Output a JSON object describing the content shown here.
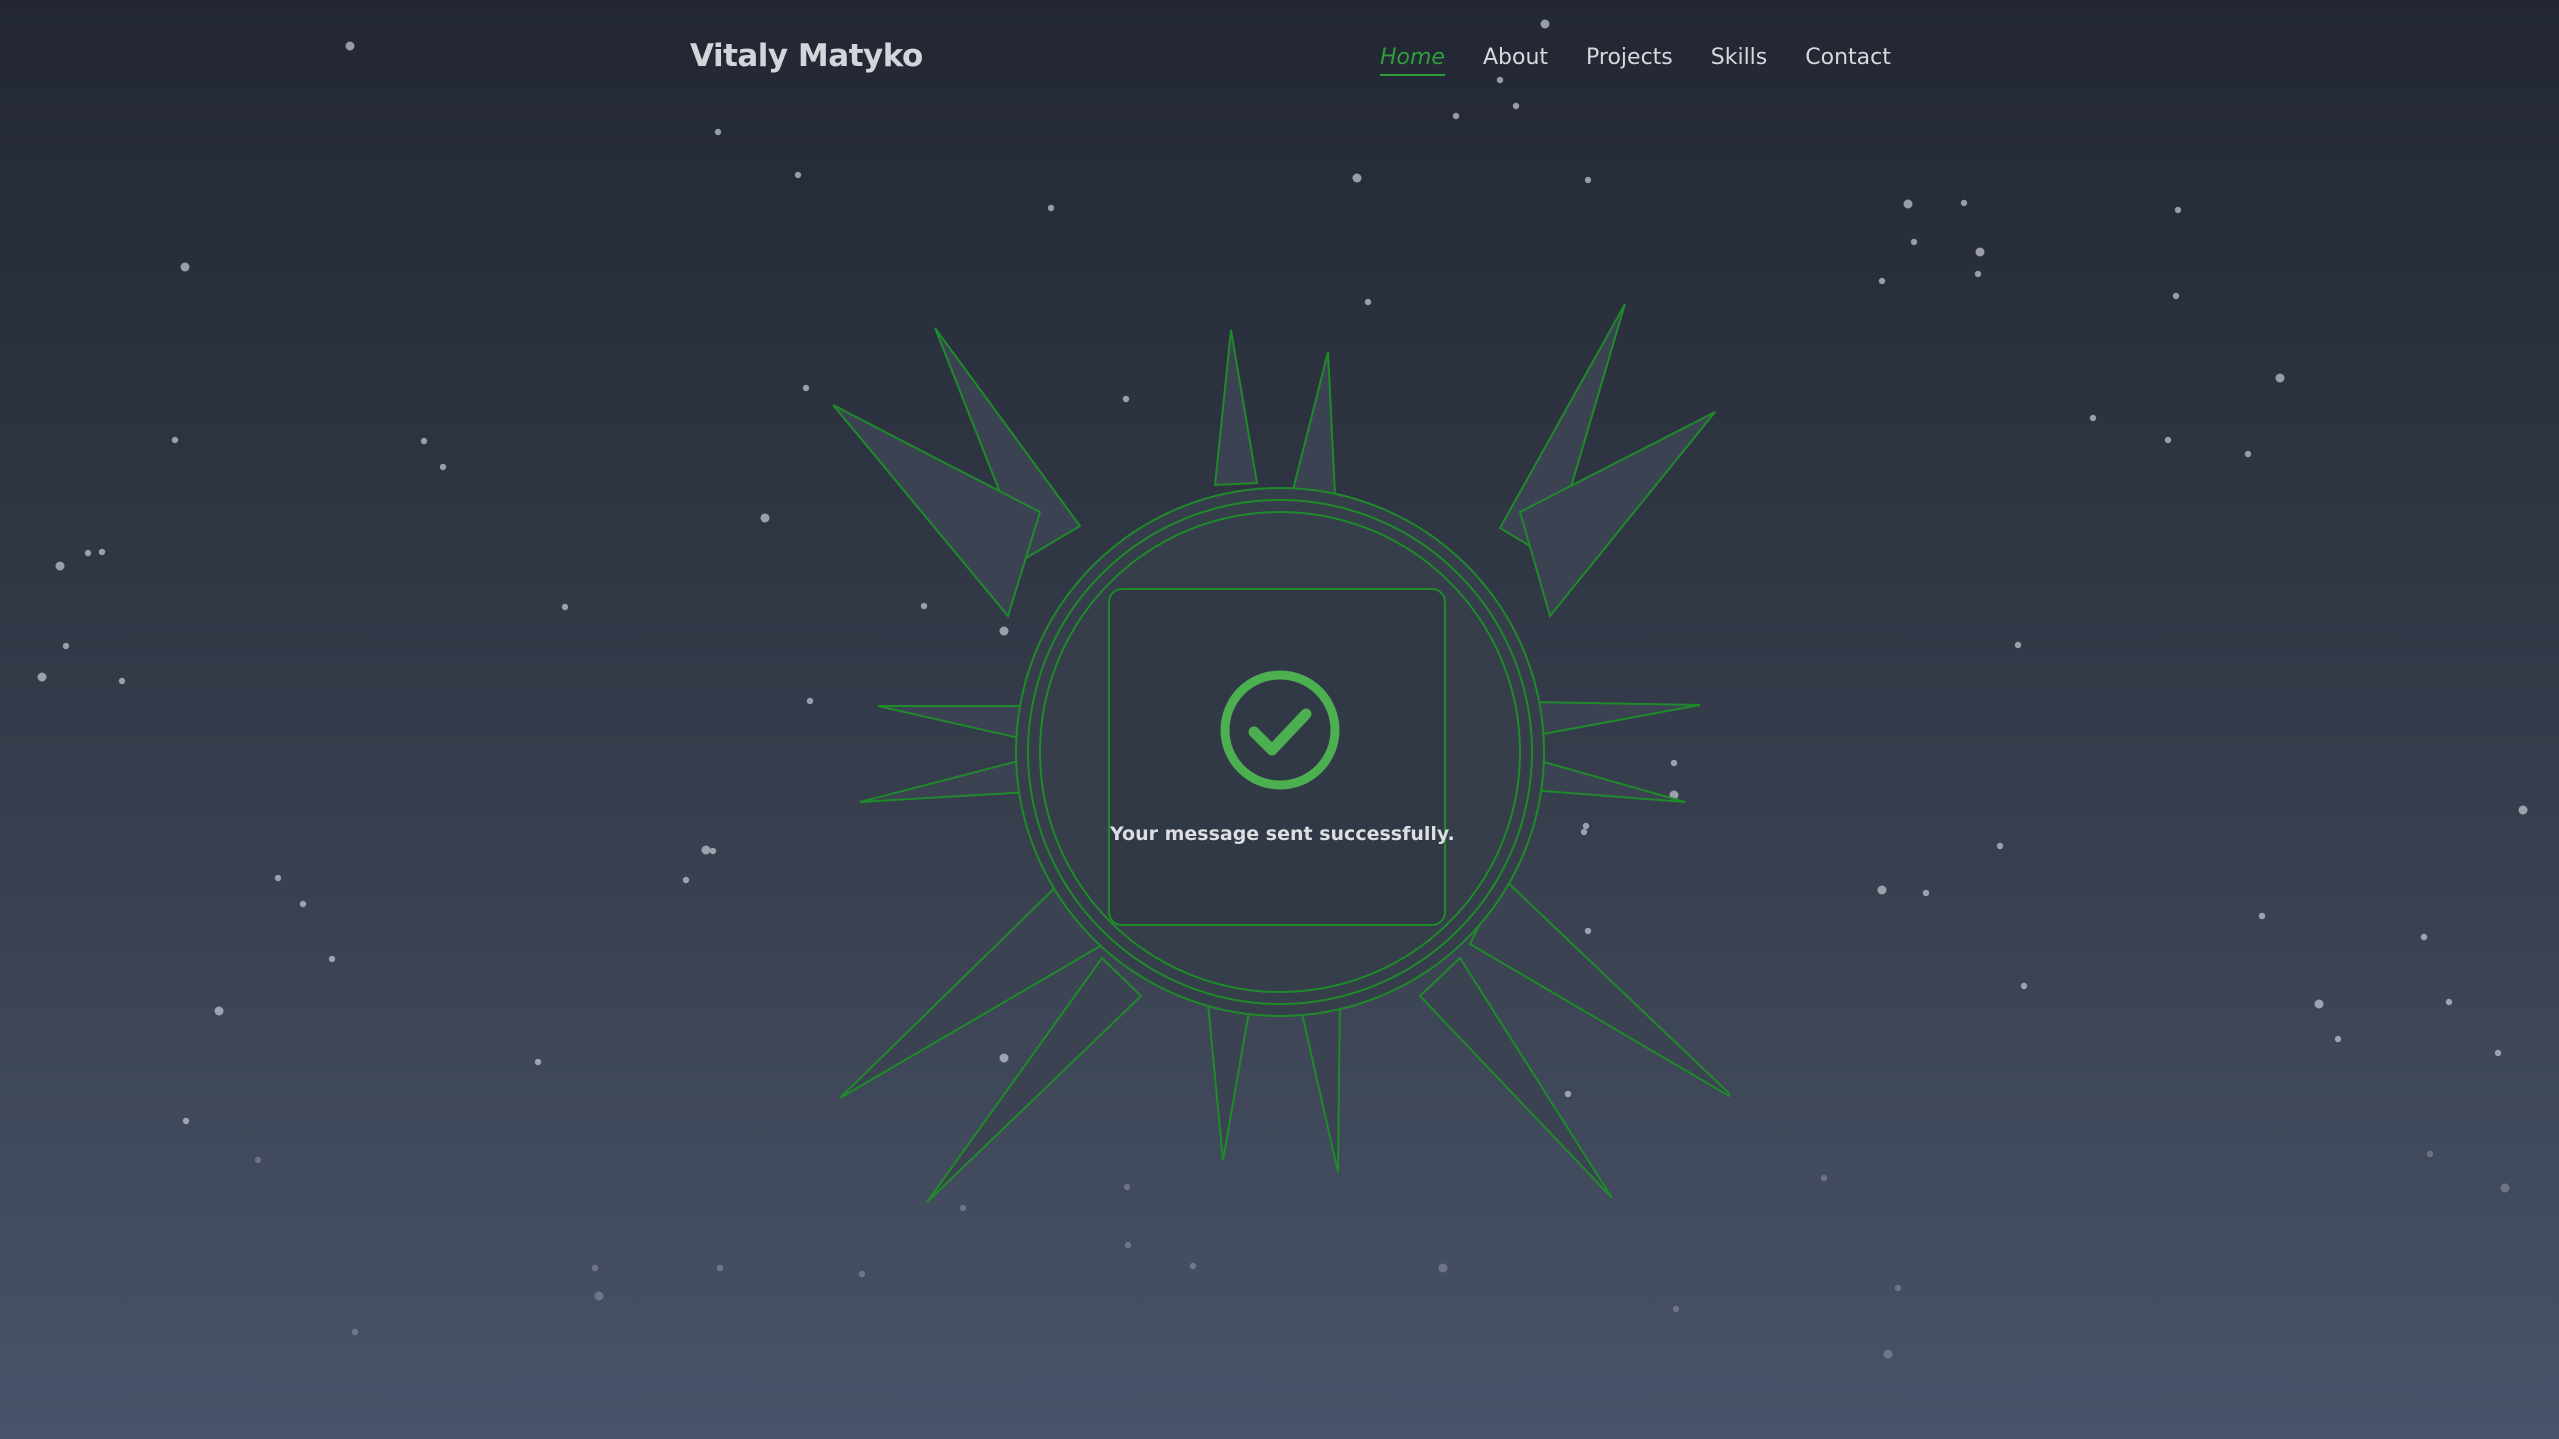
{
  "header": {
    "brand": "Vitaly Matyko",
    "nav": [
      {
        "label": "Home",
        "active": true
      },
      {
        "label": "About",
        "active": false
      },
      {
        "label": "Projects",
        "active": false
      },
      {
        "label": "Skills",
        "active": false
      },
      {
        "label": "Contact",
        "active": false
      }
    ]
  },
  "main": {
    "success_icon": "check-circle-icon",
    "message": "Your message sent successfully."
  },
  "colors": {
    "accent": "#2e9e3a",
    "accent_dark": "#1f8a29",
    "check": "#4caf50",
    "text": "#d6d8dc"
  }
}
